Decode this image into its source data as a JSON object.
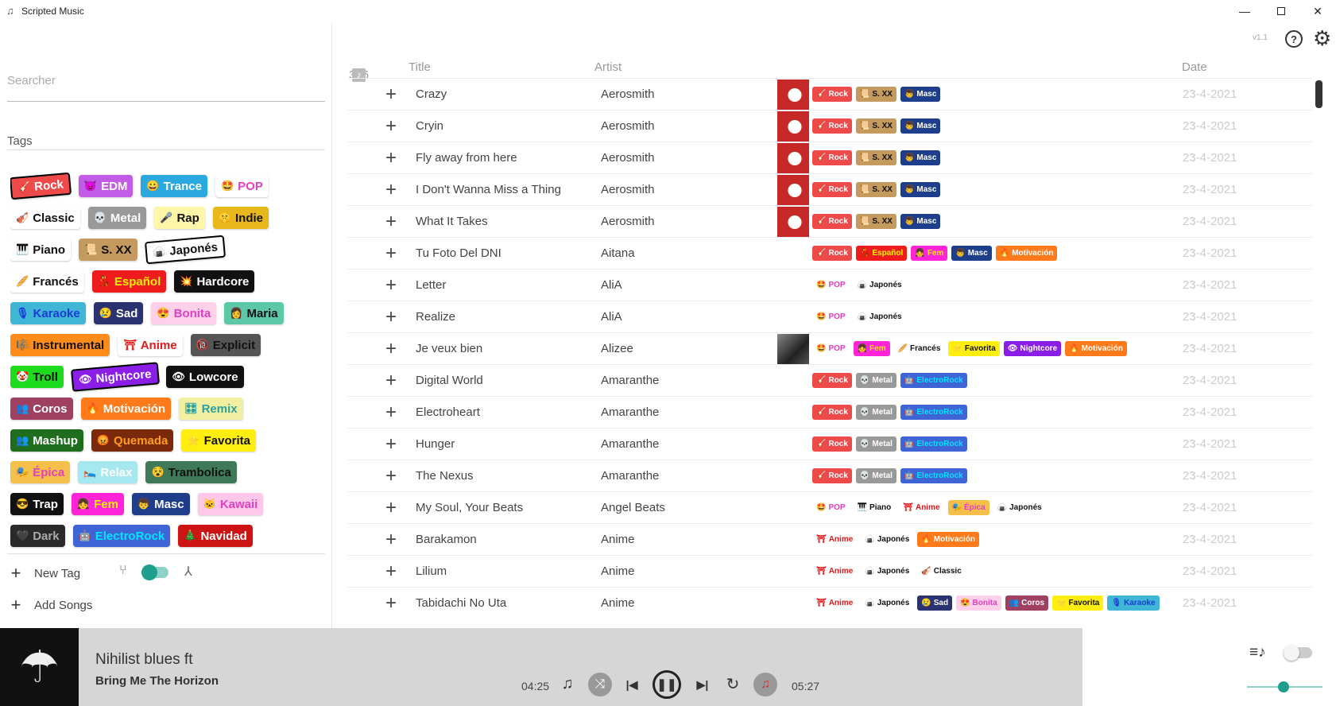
{
  "app": {
    "title": "Scripted Music",
    "icon": "music-note-icon",
    "version": "v1.1"
  },
  "window_controls": [
    "minimize-icon",
    "maximize-icon",
    "close-icon"
  ],
  "sidebar": {
    "search_placeholder": "Searcher",
    "tags_label": "Tags",
    "tags": [
      [
        {
          "label": "Rock",
          "icon": "🎸",
          "bg": "#ee4a4a",
          "fg": "#ffffff",
          "tilt": true
        },
        {
          "label": "EDM",
          "icon": "😈",
          "bg": "#c25be6",
          "fg": "#ffffff"
        },
        {
          "label": "Trance",
          "icon": "😀",
          "bg": "#2aa9e0",
          "fg": "#ffffff"
        },
        {
          "label": "POP",
          "icon": "🤩",
          "bg": "#ffffff",
          "fg": "#e040c0"
        }
      ],
      [
        {
          "label": "Classic",
          "icon": "🎻",
          "bg": "#ffffff",
          "fg": "#111111"
        },
        {
          "label": "Metal",
          "icon": "💀",
          "bg": "#999999",
          "fg": "#ffffff"
        },
        {
          "label": "Rap",
          "icon": "🎤",
          "bg": "#fff6a8",
          "fg": "#111111"
        },
        {
          "label": "Indie",
          "icon": "🤫",
          "bg": "#e8b81a",
          "fg": "#111111"
        }
      ],
      [
        {
          "label": "Piano",
          "icon": "🎹",
          "bg": "#ffffff",
          "fg": "#111111"
        },
        {
          "label": "S. XX",
          "icon": "📜",
          "bg": "#c49a5f",
          "fg": "#111111"
        },
        {
          "label": "Japonés",
          "icon": "🍙",
          "bg": "#ffffff",
          "fg": "#111111",
          "tilt": true
        }
      ],
      [
        {
          "label": "Francés",
          "icon": "🥖",
          "bg": "#ffffff",
          "fg": "#111111"
        },
        {
          "label": "Español",
          "icon": "💃",
          "bg": "#ee1c1c",
          "fg": "#ffee00"
        },
        {
          "label": "Hardcore",
          "icon": "💥",
          "bg": "#111111",
          "fg": "#ffffff"
        }
      ],
      [
        {
          "label": "Karaoke",
          "icon": "🎙",
          "bg": "#3fb6d6",
          "fg": "#1a3bd6"
        },
        {
          "label": "Sad",
          "icon": "😢",
          "bg": "#2a3270",
          "fg": "#ffffff"
        },
        {
          "label": "Bonita",
          "icon": "😍",
          "bg": "#ffd0ea",
          "fg": "#e040c0"
        },
        {
          "label": "Maria",
          "icon": "👩",
          "bg": "#5cc8a8",
          "fg": "#111111"
        }
      ],
      [
        {
          "label": "Instrumental",
          "icon": "🎼",
          "bg": "#ff8c1a",
          "fg": "#111111"
        },
        {
          "label": "Anime",
          "icon": "⛩",
          "bg": "#ffffff",
          "fg": "#e01a1a"
        },
        {
          "label": "Explicit",
          "icon": "🔞",
          "bg": "#555555",
          "fg": "#111111"
        }
      ],
      [
        {
          "label": "Troll",
          "icon": "🤡",
          "bg": "#1ddc1d",
          "fg": "#111111"
        },
        {
          "label": "Nightcore",
          "icon": "👁",
          "bg": "#8a1de6",
          "fg": "#ffffff",
          "tilt": true
        },
        {
          "label": "Lowcore",
          "icon": "👁",
          "bg": "#111111",
          "fg": "#ffffff"
        }
      ],
      [
        {
          "label": "Coros",
          "icon": "👥",
          "bg": "#a04060",
          "fg": "#ffffff"
        },
        {
          "label": "Motivación",
          "icon": "🔥",
          "bg": "#ff7a1a",
          "fg": "#ffffff"
        },
        {
          "label": "Remix",
          "icon": "🎛",
          "bg": "#f0f0a0",
          "fg": "#2aa0a0"
        }
      ],
      [
        {
          "label": "Mashup",
          "icon": "👥",
          "bg": "#1e6e1e",
          "fg": "#ffffff"
        },
        {
          "label": "Quemada",
          "icon": "😡",
          "bg": "#7a2a0a",
          "fg": "#ff9c1a"
        },
        {
          "label": "Favorita",
          "icon": "⭐",
          "bg": "#ffee10",
          "fg": "#111111"
        }
      ],
      [
        {
          "label": "Épica",
          "icon": "🎭",
          "bg": "#f5c04a",
          "fg": "#e040c0"
        },
        {
          "label": "Relax",
          "icon": "🛌",
          "bg": "#a6e8f0",
          "fg": "#ffffff"
        },
        {
          "label": "Trambolica",
          "icon": "😵",
          "bg": "#3e7a5a",
          "fg": "#111111"
        }
      ],
      [
        {
          "label": "Trap",
          "icon": "😎",
          "bg": "#111111",
          "fg": "#ffffff"
        },
        {
          "label": "Fem",
          "icon": "👧",
          "bg": "#ff24d8",
          "fg": "#ffee00"
        },
        {
          "label": "Masc",
          "icon": "👦",
          "bg": "#1e3e8c",
          "fg": "#ffffff"
        },
        {
          "label": "Kawaii",
          "icon": "🐱",
          "bg": "#ffc8e8",
          "fg": "#e040c0"
        }
      ],
      [
        {
          "label": "Dark",
          "icon": "🖤",
          "bg": "#2a2a2a",
          "fg": "#aaaaaa"
        },
        {
          "label": "ElectroRock",
          "icon": "🤖",
          "bg": "#3e64d6",
          "fg": "#00e6ff"
        },
        {
          "label": "Navidad",
          "icon": "🎄",
          "bg": "#cc1414",
          "fg": "#ffffff"
        }
      ]
    ],
    "new_tag_label": "New Tag",
    "add_songs_label": "Add Songs",
    "toggle_left_icon": "split-icon",
    "toggle_right_icon": "merge-icon"
  },
  "table": {
    "count": "376",
    "count_icon": "music-library-icon",
    "col_title": "Title",
    "col_artist": "Artist",
    "col_date": "Date",
    "rows": [
      {
        "title": "Crazy",
        "artist": "Aerosmith",
        "date": "23-4-2021",
        "cover": "aerosmith",
        "tags": [
          "Rock",
          "S. XX",
          "Masc"
        ]
      },
      {
        "title": "Cryin",
        "artist": "Aerosmith",
        "date": "23-4-2021",
        "cover": "aerosmith",
        "tags": [
          "Rock",
          "S. XX",
          "Masc"
        ]
      },
      {
        "title": "Fly away from here",
        "artist": "Aerosmith",
        "date": "23-4-2021",
        "cover": "aerosmith",
        "tags": [
          "Rock",
          "S. XX",
          "Masc"
        ]
      },
      {
        "title": "I Don't Wanna Miss a Thing",
        "artist": "Aerosmith",
        "date": "23-4-2021",
        "cover": "aerosmith",
        "tags": [
          "Rock",
          "S. XX",
          "Masc"
        ]
      },
      {
        "title": "What It Takes",
        "artist": "Aerosmith",
        "date": "23-4-2021",
        "cover": "aerosmith",
        "tags": [
          "Rock",
          "S. XX",
          "Masc"
        ]
      },
      {
        "title": "Tu Foto Del DNI",
        "artist": "Aitana",
        "date": "23-4-2021",
        "cover": "",
        "tags": [
          "Rock",
          "Español",
          "Fem",
          "Masc",
          "Motivación"
        ]
      },
      {
        "title": "Letter",
        "artist": "AliA",
        "date": "23-4-2021",
        "cover": "",
        "tags": [
          "POP",
          "Japonés"
        ]
      },
      {
        "title": "Realize",
        "artist": "AliA",
        "date": "23-4-2021",
        "cover": "",
        "tags": [
          "POP",
          "Japonés"
        ]
      },
      {
        "title": "Je veux bien",
        "artist": "Alizee",
        "date": "23-4-2021",
        "cover": "alizee",
        "tags": [
          "POP",
          "Fem",
          "Francés",
          "Favorita",
          "Nightcore",
          "Motivación"
        ]
      },
      {
        "title": "Digital World",
        "artist": "Amaranthe",
        "date": "23-4-2021",
        "cover": "",
        "tags": [
          "Rock",
          "Metal",
          "ElectroRock"
        ]
      },
      {
        "title": "Electroheart",
        "artist": "Amaranthe",
        "date": "23-4-2021",
        "cover": "",
        "tags": [
          "Rock",
          "Metal",
          "ElectroRock"
        ]
      },
      {
        "title": "Hunger",
        "artist": "Amaranthe",
        "date": "23-4-2021",
        "cover": "",
        "tags": [
          "Rock",
          "Metal",
          "ElectroRock"
        ]
      },
      {
        "title": "The Nexus",
        "artist": "Amaranthe",
        "date": "23-4-2021",
        "cover": "",
        "tags": [
          "Rock",
          "Metal",
          "ElectroRock"
        ]
      },
      {
        "title": "My Soul, Your Beats",
        "artist": "Angel Beats",
        "date": "23-4-2021",
        "cover": "",
        "tags": [
          "POP",
          "Piano",
          "Anime",
          "Épica",
          "Japonés"
        ]
      },
      {
        "title": "Barakamon",
        "artist": "Anime",
        "date": "23-4-2021",
        "cover": "",
        "tags": [
          "Anime",
          "Japonés",
          "Motivación"
        ]
      },
      {
        "title": "Lilium",
        "artist": "Anime",
        "date": "23-4-2021",
        "cover": "",
        "tags": [
          "Anime",
          "Japonés",
          "Classic"
        ]
      },
      {
        "title": "Tabidachi No Uta",
        "artist": "Anime",
        "date": "23-4-2021",
        "cover": "",
        "tags": [
          "Anime",
          "Japonés",
          "Sad",
          "Bonita",
          "Coros",
          "Favorita",
          "Karaoke"
        ]
      }
    ]
  },
  "player": {
    "song_title": "Nihilist blues ft",
    "song_artist": "Bring Me The Horizon",
    "time_current": "04:25",
    "time_total": "05:27",
    "album_icon": "umbrella-icon",
    "volume": 0.48
  },
  "colors": {
    "accent": "#1f9e8e",
    "accent_light": "#8fd1c8",
    "player_bg": "#d6d6d6"
  }
}
